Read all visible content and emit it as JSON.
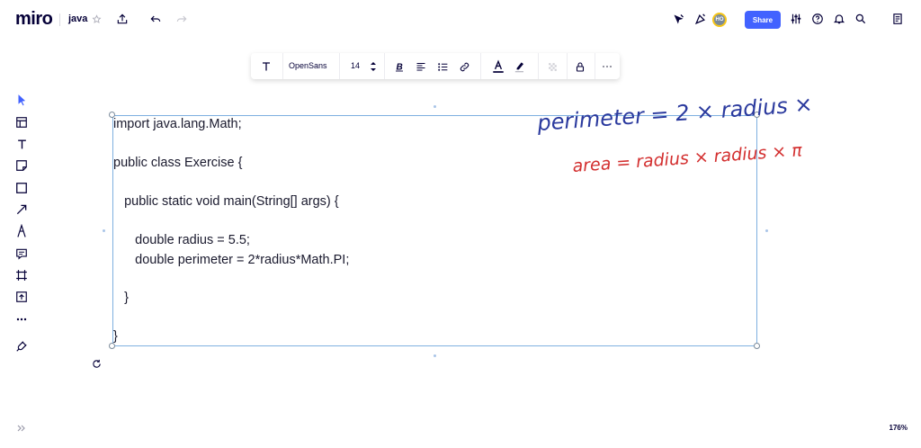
{
  "app": {
    "logo": "miro",
    "board_title": "java"
  },
  "top_right": {
    "share_label": "Share",
    "avatar_initials": "HO"
  },
  "text_toolbar": {
    "font_name": "OpenSans",
    "font_size": "14"
  },
  "code_lines": [
    "import java.lang.Math;",
    "",
    "public class Exercise {",
    "",
    "   public static void main(String[] args) {",
    "",
    "      double radius = 5.5;",
    "      double perimeter = 2*radius*Math.PI;",
    "",
    "   }",
    "",
    "}"
  ],
  "handwriting": {
    "line1": "perimeter = 2 × radius × π",
    "line2": "area = radius × radius × π",
    "line1_color": "#2b3a9e",
    "line2_color": "#d32f2f"
  },
  "zoom_level": "176%",
  "colors": {
    "accent": "#4262ff",
    "frame": "#7fb0e0"
  }
}
